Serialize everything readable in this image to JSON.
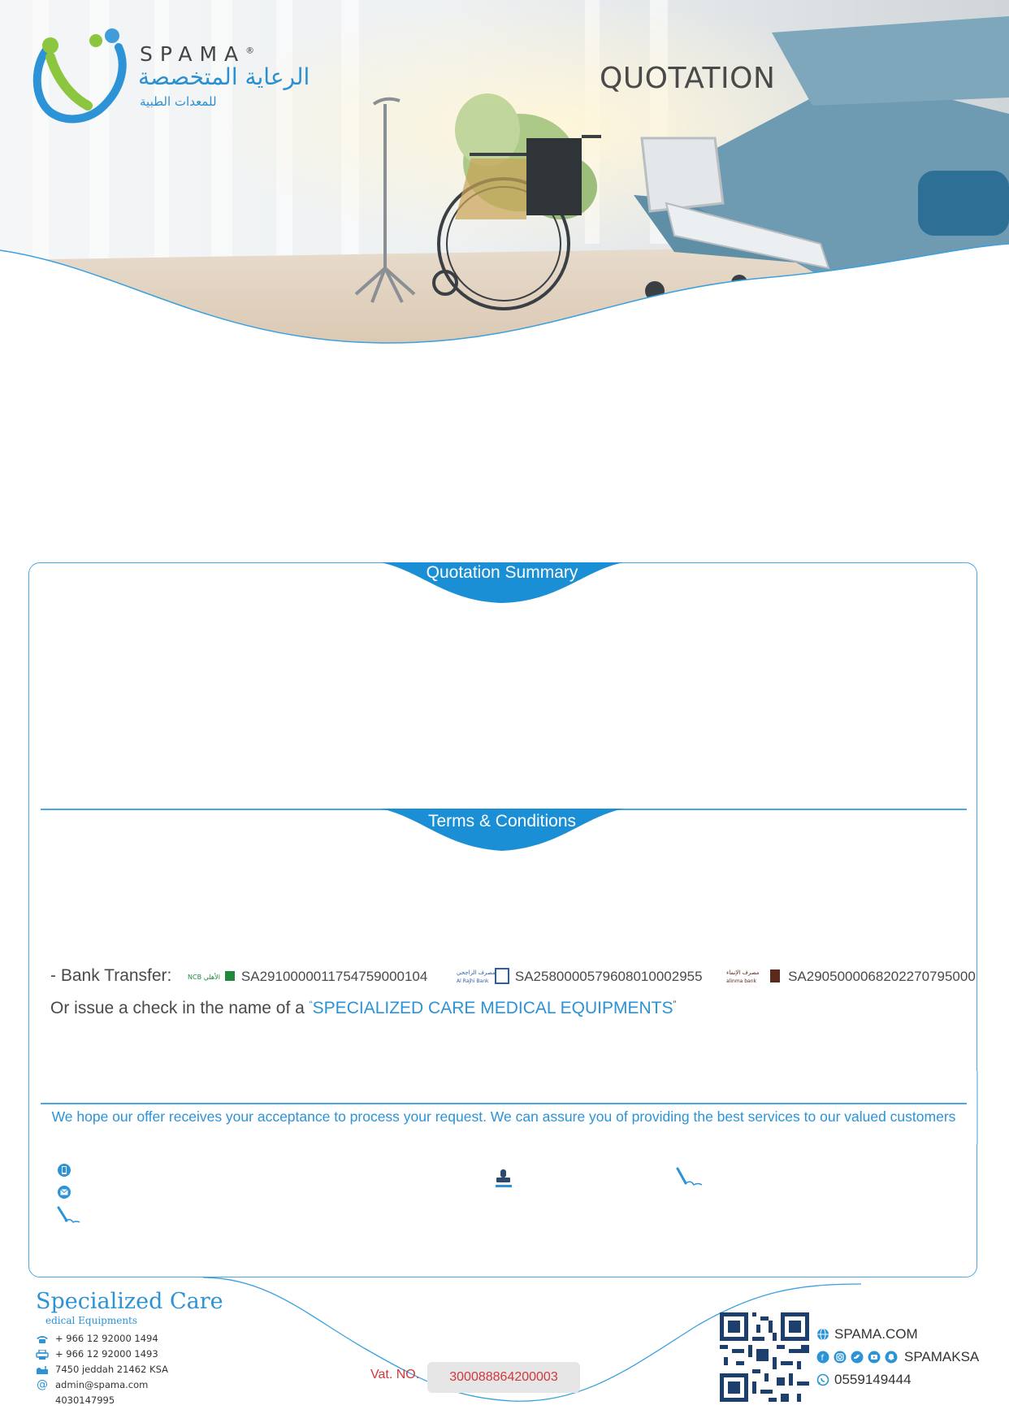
{
  "header": {
    "logo": {
      "brand": "SPAMA",
      "registered": "®",
      "arabic_line1": "الرعاية المتخصصة",
      "arabic_line2": "للمعدات الطبية"
    },
    "title": "QUOTATION"
  },
  "sections": {
    "summary_title": "Quotation Summary",
    "terms_title": "Terms & Conditions"
  },
  "bank": {
    "label": "- Bank Transfer:",
    "accounts": [
      {
        "bank_name": "NCB الأهلي",
        "iban": "SA2910000011754759000104",
        "icon": "ncb-bank-icon",
        "color": "#1f8a3c"
      },
      {
        "bank_name": "Al Rajhi Bank مصرف الراجحي",
        "iban": "SA2580000579608010002955",
        "icon": "alrajhi-bank-icon",
        "color": "#2c5ea8"
      },
      {
        "bank_name": "alinma bank مصرف الإنماء",
        "iban": "SA2905000068202270795000",
        "icon": "alinma-bank-icon",
        "color": "#5a2a1e"
      }
    ]
  },
  "check": {
    "prefix": "Or issue a check in the name of a",
    "company": "SPECIALIZED CARE MEDICAL EQUIPMENTS"
  },
  "closing_text": "We hope our offer receives your acceptance to process your request. We can assure you of providing the best services to our valued customers",
  "icons": {
    "phone": "mobile-phone-icon",
    "email": "envelope-icon",
    "signature": "signature-pen-icon",
    "stamp": "stamp-icon"
  },
  "footer": {
    "brand_name": "Specialized Care",
    "brand_sub": "edical Equipments",
    "contacts": [
      {
        "icon": "telephone-icon",
        "text": "+ 966 12 92000 1494"
      },
      {
        "icon": "printer-icon",
        "text": "+ 966 12 92000 1493"
      },
      {
        "icon": "mailbox-icon",
        "text": "7450 jeddah 21462 KSA"
      },
      {
        "icon": "at-icon",
        "text": "admin@spama.com"
      },
      {
        "icon": "",
        "text": "4030147995"
      }
    ],
    "vat_label": "Vat. NO.",
    "vat_number": "300088864200003",
    "website": "SPAMA.COM",
    "social_handle": "SPAMAKSA",
    "whatsapp": "0559149444"
  },
  "colors": {
    "accent": "#2b93d6",
    "border": "#49a8e2",
    "vat": "#d0383c"
  }
}
